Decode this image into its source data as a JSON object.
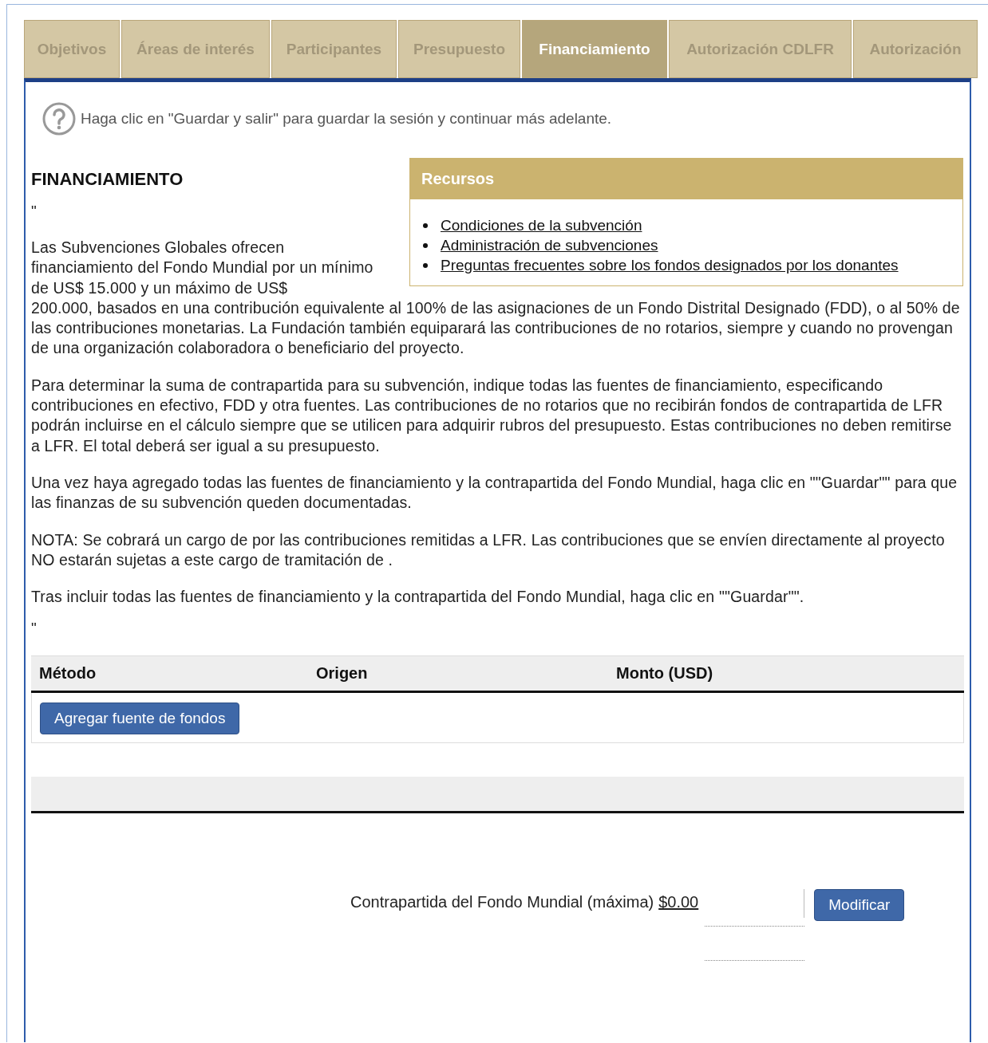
{
  "tabs": [
    {
      "label": "Objetivos",
      "selected": false
    },
    {
      "label": "Áreas de interés",
      "selected": false
    },
    {
      "label": "Participantes",
      "selected": false
    },
    {
      "label": "Presupuesto",
      "selected": false
    },
    {
      "label": "Financiamiento",
      "selected": true
    },
    {
      "label": "Autorización CDLFR",
      "selected": false
    },
    {
      "label": "Autorización",
      "selected": false
    }
  ],
  "help_text": "Haga clic en \"Guardar y salir\" para guardar la sesión y continuar más adelante.",
  "heading": "FINANCIAMIENTO",
  "resources": {
    "title": "Recursos",
    "links": [
      "Condiciones de la subvención",
      "Administración de subvenciones",
      "Preguntas frecuentes sobre los fondos designados por los donantes"
    ]
  },
  "quote_open": "\"",
  "intro": "Las Subvenciones Globales ofrecen financiamiento del Fondo Mundial por un mínimo de US$ 15.000 y un máximo de US$",
  "paragraphs": [
    "200.000, basados en una contribución equivalente al 100% de las asignaciones de un Fondo Distrital Designado (FDD), o al 50% de las contribuciones monetarias. La Fundación también equiparará las contribuciones de no rotarios, siempre y cuando no provengan de una organización colaboradora o beneficiario del proyecto.",
    "Para determinar la suma de contrapartida para su subvención, indique todas las fuentes de financiamiento, especificando contribuciones en efectivo, FDD y otra fuentes. Las contribuciones de no rotarios que no recibirán fondos de contrapartida de LFR podrán incluirse en el cálculo siempre que se utilicen para adquirir rubros del presupuesto. Estas contribuciones no deben remitirse a LFR. El total deberá ser igual a su presupuesto.",
    "Una vez haya agregado todas las fuentes de financiamiento y la contrapartida del Fondo Mundial, haga clic en \"\"Guardar\"\" para que las finanzas de su subvención queden documentadas.",
    "NOTA: Se cobrará un cargo de por las contribuciones remitidas a LFR. Las contribuciones que se envíen directamente al proyecto NO estarán sujetas a este cargo de tramitación de .",
    "Tras incluir todas las fuentes de financiamiento y la contrapartida del Fondo Mundial, haga clic en \"\"Guardar\"\"."
  ],
  "quote_close": "\"",
  "table": {
    "columns": [
      "Método",
      "Origen",
      "Monto (USD)"
    ],
    "add_button": "Agregar fuente de fondos"
  },
  "match": {
    "label": "Contrapartida del Fondo Mundial (máxima)",
    "amount": "$0.00",
    "button": "Modificar"
  }
}
